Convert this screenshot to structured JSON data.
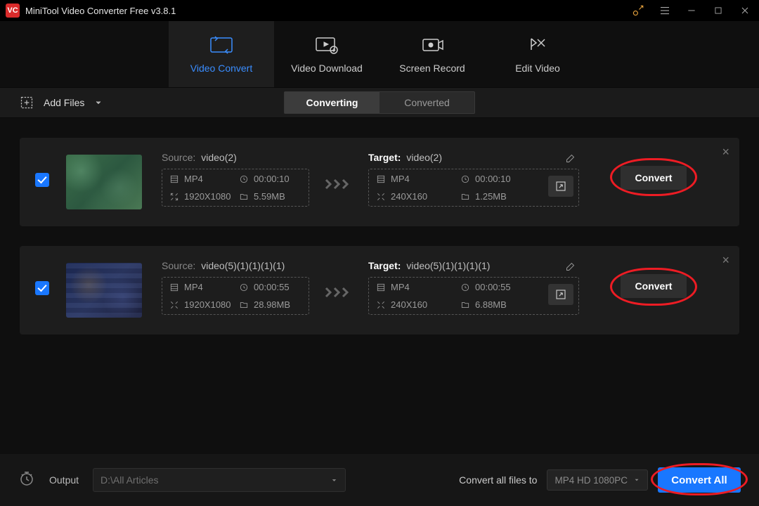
{
  "title": "MiniTool Video Converter Free v3.8.1",
  "tabs": {
    "convert": "Video Convert",
    "download": "Video Download",
    "record": "Screen Record",
    "edit": "Edit Video"
  },
  "toolbar": {
    "add_files": "Add Files",
    "converting": "Converting",
    "converted": "Converted"
  },
  "labels": {
    "source": "Source:",
    "target": "Target:",
    "convert": "Convert"
  },
  "items": [
    {
      "source": {
        "name": "video(2)",
        "format": "MP4",
        "duration": "00:00:10",
        "resolution": "1920X1080",
        "size": "5.59MB"
      },
      "target": {
        "name": "video(2)",
        "format": "MP4",
        "duration": "00:00:10",
        "resolution": "240X160",
        "size": "1.25MB"
      }
    },
    {
      "source": {
        "name": "video(5)(1)(1)(1)(1)",
        "format": "MP4",
        "duration": "00:00:55",
        "resolution": "1920X1080",
        "size": "28.98MB"
      },
      "target": {
        "name": "video(5)(1)(1)(1)(1)",
        "format": "MP4",
        "duration": "00:00:55",
        "resolution": "240X160",
        "size": "6.88MB"
      }
    }
  ],
  "footer": {
    "output_label": "Output",
    "output_path": "D:\\All Articles",
    "convert_to_label": "Convert all files to",
    "format": "MP4 HD 1080PC",
    "convert_all": "Convert All"
  }
}
